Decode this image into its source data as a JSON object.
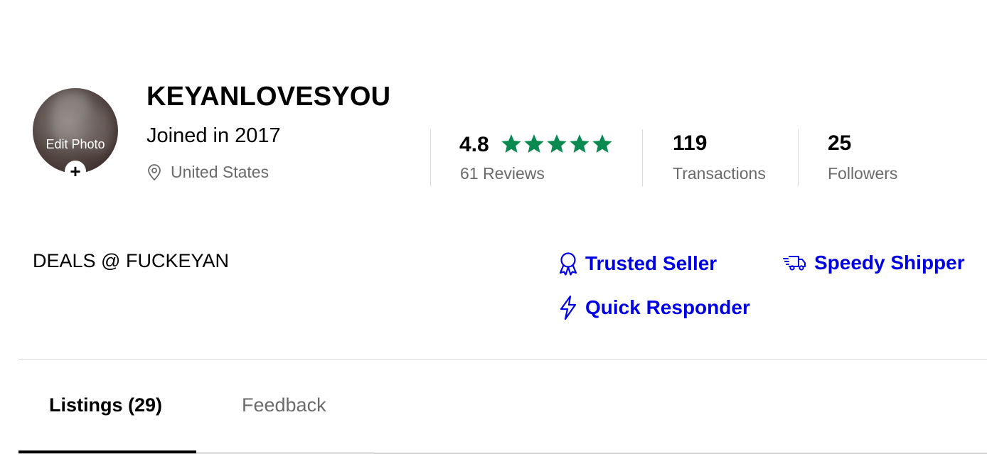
{
  "profile": {
    "avatar_edit_label": "Edit Photo",
    "avatar_plus": "+",
    "username": "KEYANLOVESYOU",
    "joined": "Joined in 2017",
    "location": "United States",
    "location_icon": "location-pin-icon"
  },
  "stats": {
    "rating": "4.8",
    "rating_stars": 5,
    "star_color": "#0a8a4f",
    "reviews_label": "61 Reviews",
    "transactions_count": "119",
    "transactions_label": "Transactions",
    "followers_count": "25",
    "followers_label": "Followers"
  },
  "bio": "DEALS @ FUCKEYAN",
  "badges": {
    "color": "#0000e6",
    "trusted": {
      "label": "Trusted Seller",
      "icon": "ribbon-award-icon"
    },
    "speedy": {
      "label": "Speedy Shipper",
      "icon": "delivery-truck-icon"
    },
    "quick": {
      "label": "Quick Responder",
      "icon": "lightning-bolt-icon"
    }
  },
  "tabs": {
    "listings": "Listings (29)",
    "feedback": "Feedback",
    "active": "listings"
  }
}
